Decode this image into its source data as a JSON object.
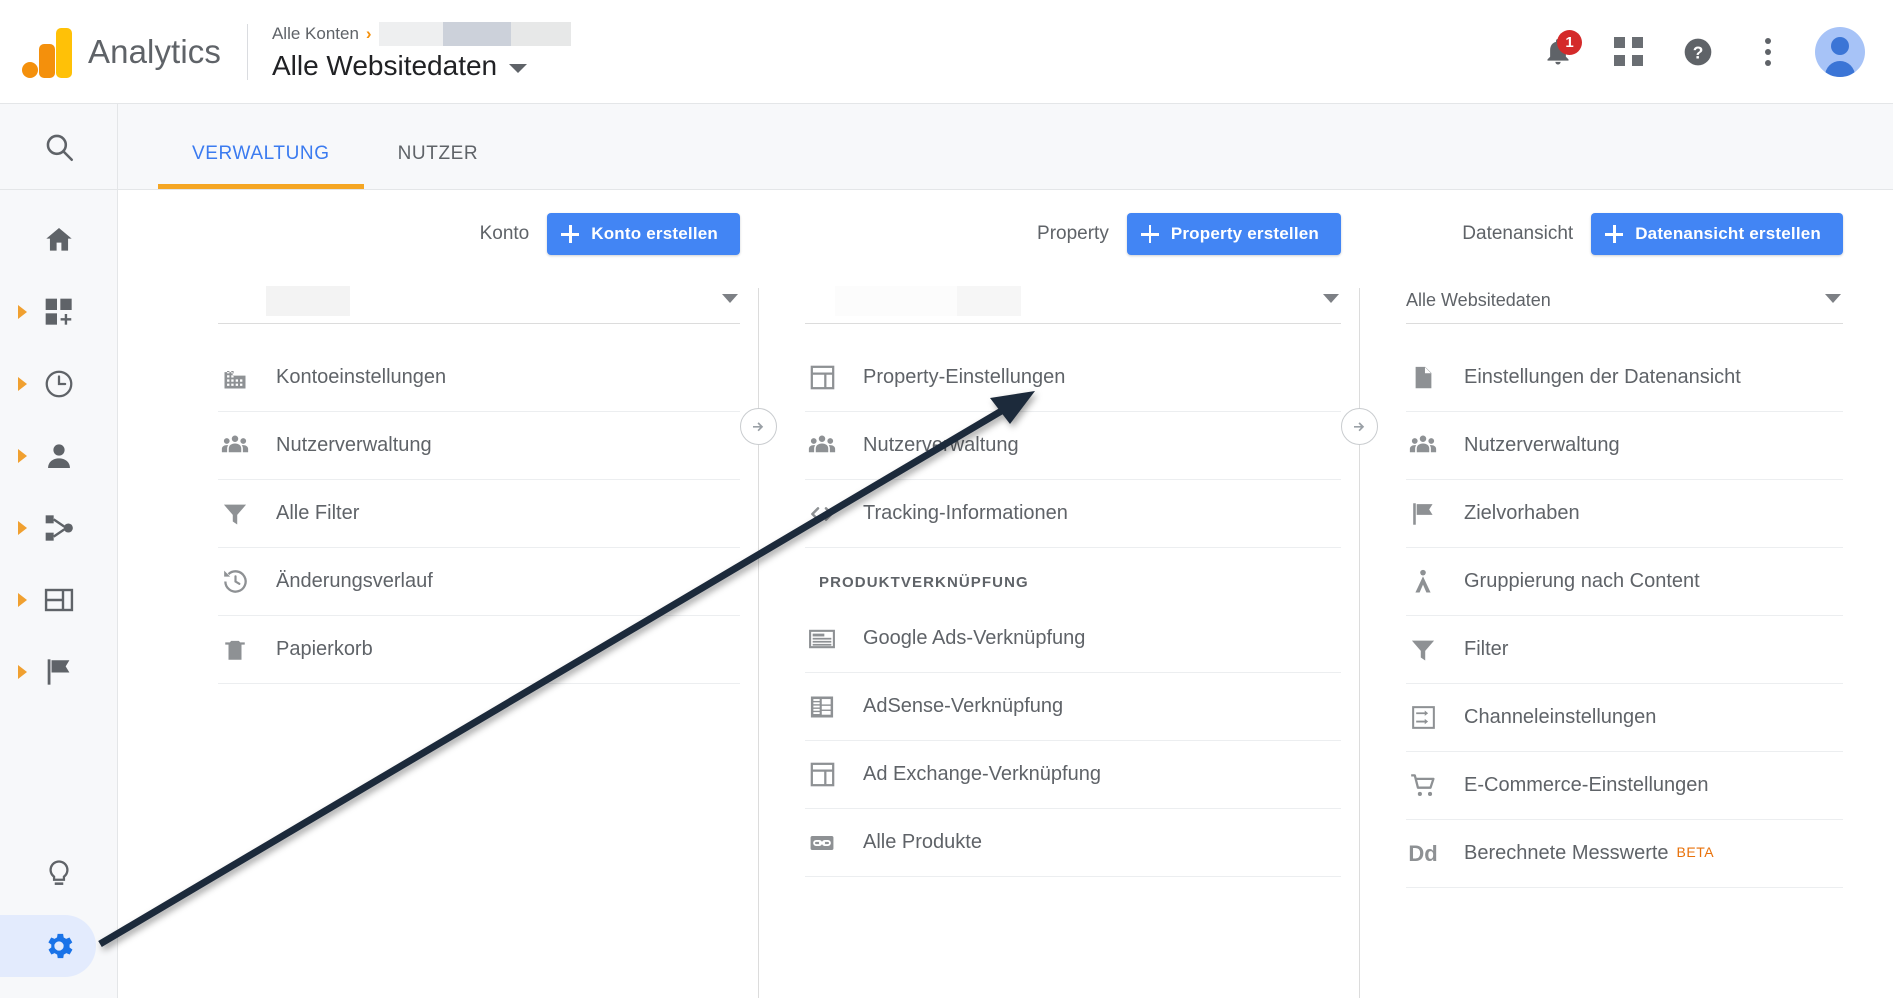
{
  "header": {
    "brand": "Analytics",
    "breadcrumb_root": "Alle Konten",
    "breadcrumb_separator": "›",
    "view_title": "Alle Websitedaten",
    "notification_count": "1",
    "icons": {
      "bell": "notifications-icon",
      "apps": "apps-grid-icon",
      "help": "help-icon",
      "more": "more-options-icon",
      "avatar": "account-avatar"
    }
  },
  "rail": {
    "search": "search-icon",
    "items": [
      {
        "icon": "home-icon",
        "expandable": false
      },
      {
        "icon": "customization-icon",
        "expandable": true
      },
      {
        "icon": "realtime-clock-icon",
        "expandable": true
      },
      {
        "icon": "audience-person-icon",
        "expandable": true
      },
      {
        "icon": "acquisition-share-icon",
        "expandable": true
      },
      {
        "icon": "behavior-layout-icon",
        "expandable": true
      },
      {
        "icon": "conversions-flag-icon",
        "expandable": true
      }
    ],
    "bottom": [
      {
        "icon": "discover-bulb-icon",
        "active": false
      },
      {
        "icon": "admin-gear-icon",
        "active": true
      }
    ]
  },
  "tabs": [
    {
      "label": "VERWALTUNG",
      "active": true
    },
    {
      "label": "NUTZER",
      "active": false
    }
  ],
  "columns": [
    {
      "key": "konto",
      "head_label": "Konto",
      "create_label": "Konto erstellen",
      "selector_value": "",
      "selector_redacted": true,
      "items": [
        {
          "label": "Kontoeinstellungen",
          "icon": "building-icon"
        },
        {
          "label": "Nutzerverwaltung",
          "icon": "people-icon"
        },
        {
          "label": "Alle Filter",
          "icon": "funnel-icon"
        },
        {
          "label": "Änderungsverlauf",
          "icon": "history-icon"
        },
        {
          "label": "Papierkorb",
          "icon": "trash-icon"
        }
      ]
    },
    {
      "key": "property",
      "head_label": "Property",
      "create_label": "Property erstellen",
      "selector_value": "",
      "selector_redacted": true,
      "items": [
        {
          "label": "Property-Einstellungen",
          "icon": "layout-icon"
        },
        {
          "label": "Nutzerverwaltung",
          "icon": "people-icon"
        },
        {
          "label": "Tracking-Informationen",
          "icon": "code-icon"
        }
      ],
      "section": {
        "title": "PRODUKTVERKNÜPFUNG",
        "items": [
          {
            "label": "Google Ads-Verknüpfung",
            "icon": "ads-card-icon"
          },
          {
            "label": "AdSense-Verknüpfung",
            "icon": "adsense-icon"
          },
          {
            "label": "Ad Exchange-Verknüpfung",
            "icon": "layout-icon"
          },
          {
            "label": "Alle Produkte",
            "icon": "link-icon"
          }
        ]
      }
    },
    {
      "key": "datenansicht",
      "head_label": "Datenansicht",
      "create_label": "Datenansicht erstellen",
      "selector_value": "Alle Websitedaten",
      "selector_redacted": false,
      "items": [
        {
          "label": "Einstellungen der Datenansicht",
          "icon": "document-icon"
        },
        {
          "label": "Nutzerverwaltung",
          "icon": "people-icon"
        },
        {
          "label": "Zielvorhaben",
          "icon": "flag-icon"
        },
        {
          "label": "Gruppierung nach Content",
          "icon": "content-grouping-icon"
        },
        {
          "label": "Filter",
          "icon": "funnel-icon"
        },
        {
          "label": "Channeleinstellungen",
          "icon": "channels-icon"
        },
        {
          "label": "E-Commerce-Einstellungen",
          "icon": "cart-icon"
        },
        {
          "label": "Berechnete Messwerte",
          "icon": "dd-icon",
          "badge": "BETA"
        }
      ]
    }
  ],
  "colors": {
    "accent_blue": "#4285f4",
    "brand_orange": "#f4900c",
    "brand_yellow": "#ffc107",
    "tab_underline": "#f5a623",
    "text_grey": "#5f6368",
    "badge_red": "#d42a2a",
    "beta_orange": "#e8710a",
    "annotation_arrow": "#1f2a3a"
  },
  "annotation": {
    "type": "arrow",
    "from": "admin-gear-icon",
    "to": "Property-Einstellungen"
  }
}
